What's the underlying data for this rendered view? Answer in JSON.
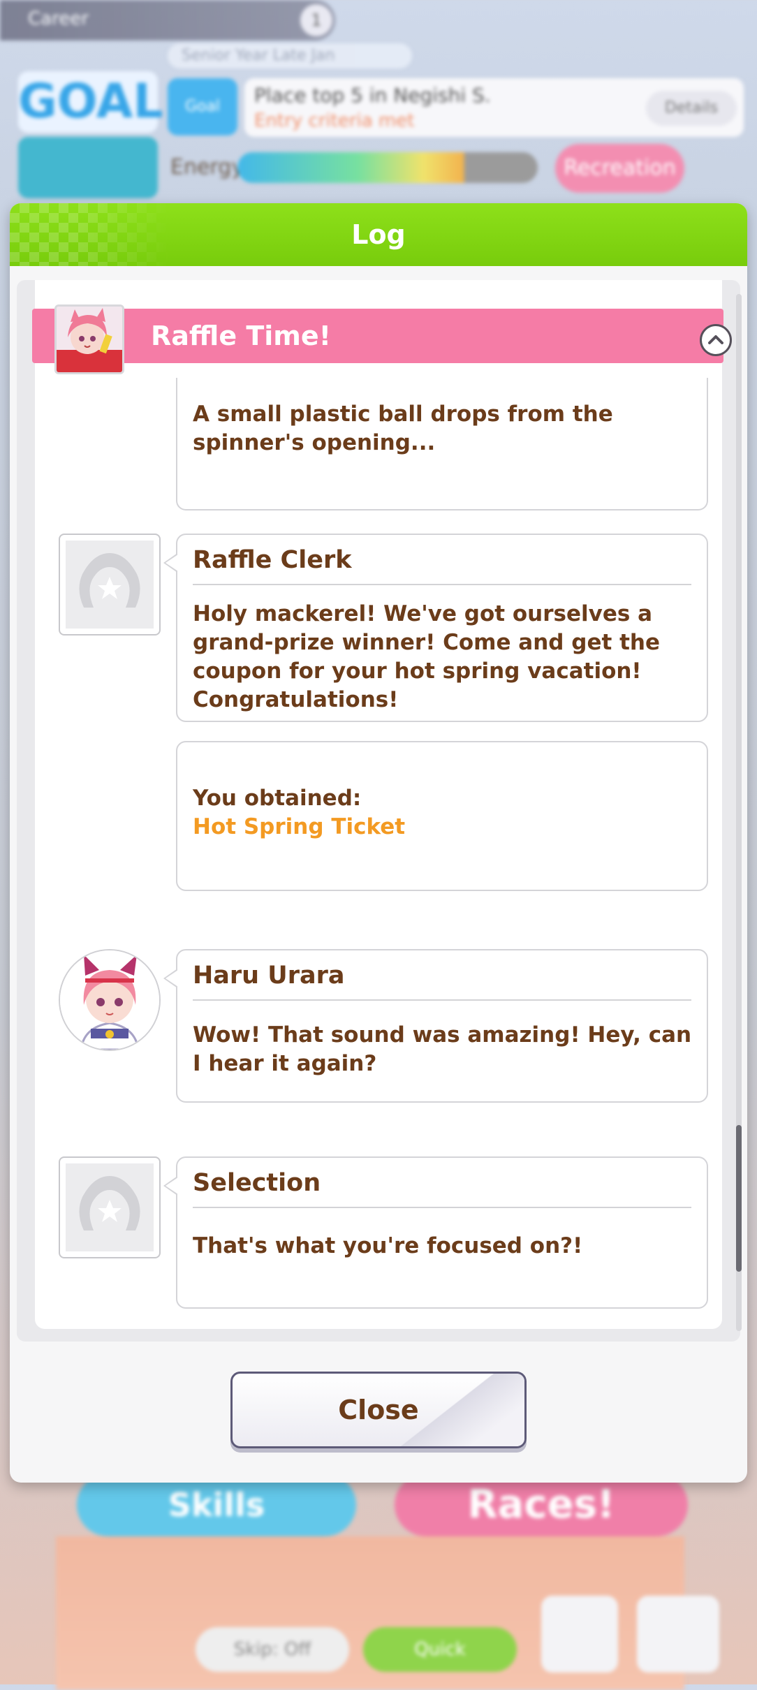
{
  "background": {
    "top_label": "Career",
    "turn_badge": "1",
    "subtitle": "Senior Year Late Jan",
    "goal_label": "GOAL",
    "goal_button": "Goal",
    "goal_text": "Place top 5 in Negishi S.",
    "goal_subtext": "Entry criteria met",
    "details_button": "Details",
    "energy_label": "Energy",
    "recreation_button": "Recreation",
    "skills_button": "Skills",
    "race_button": "Races!",
    "skip_button": "Skip: Off",
    "quick_button": "Quick"
  },
  "dialog": {
    "title": "Log",
    "section_title": "Raffle Time!",
    "close_label": "Close"
  },
  "entries": [
    {
      "speaker": "",
      "text": "A small plastic ball drops from the\nspinner's opening..."
    },
    {
      "speaker": "Raffle Clerk",
      "text": "Holy mackerel! We've got ourselves a\ngrand-prize winner! Come and get the\ncoupon for your hot spring vacation!\nCongratulations!"
    },
    {
      "speaker": "",
      "text": "You obtained:",
      "item": "Hot Spring Ticket"
    },
    {
      "speaker": "Haru Urara",
      "text": "Wow! That sound was amazing! Hey, can\nI hear it again?"
    },
    {
      "speaker": "Selection",
      "text": "That's what you're focused on?!"
    }
  ],
  "colors": {
    "header_green": "#7ed50f",
    "section_pink": "#f57ca6",
    "text_brown": "#6b3c1a",
    "item_orange": "#f39a22"
  }
}
